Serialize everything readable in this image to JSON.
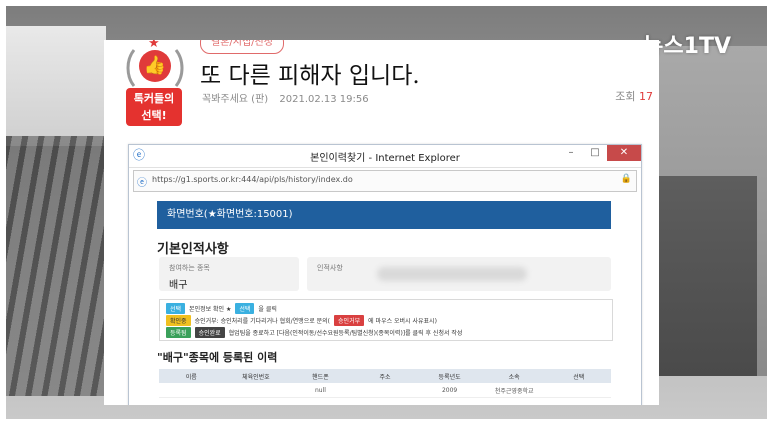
{
  "broadcast": {
    "watermark": "뉴스1TV"
  },
  "post": {
    "badge_label": "톡커들의\n선택!",
    "category": "결혼/시집/친정",
    "title": "또 다른 피해자 입니다.",
    "author": "꼭봐주세요 (판)",
    "datetime": "2021.02.13 19:56",
    "views_label": "조회",
    "views_value": "17"
  },
  "browser": {
    "title": "본인이력찾기 - Internet Explorer",
    "url": "https://g1.sports.or.kr:444/api/pls/history/index.do",
    "min_label": "–",
    "max_label": "□",
    "close_label": "✕"
  },
  "page": {
    "screen_number": "화면번호(★화면번호:15001)",
    "section_title": "기본인적사항",
    "sport_label": "참여하는 종목",
    "sport_value": "배구",
    "info_label": "인적사항",
    "legend": [
      {
        "chip": "선택",
        "chip_color": "blue",
        "text": "본인정보 확인 ★",
        "chip2": "선택",
        "text2": "을 클릭"
      },
      {
        "chip": "확인중",
        "chip_color": "yellow",
        "text": "승인거부: 승인처리를 기다리거나 협회/연맹으로 문의(",
        "chip2": "승인거부",
        "text2": "에 마우스 오버시 사유표시)"
      },
      {
        "chip": "등록됨",
        "chip_color": "green",
        "text": "",
        "chip2": "승인완료",
        "text2": "협업팀을 종료하고 [다음(인적이동/선수요원등록/팀별신청)(종목이력)]를 클릭 후 신청서 작성"
      }
    ],
    "registered_title": "\"배구\"종목에 등록된 이력",
    "table_headers": [
      "이름",
      "체육인번호",
      "핸드폰",
      "주소",
      "등록년도",
      "소속",
      "선택"
    ],
    "table_rows": [
      [
        "",
        "",
        "null",
        "",
        "2009",
        "천주근영중학교",
        ""
      ]
    ]
  },
  "icons": {
    "ie": "ie-logo-icon",
    "lock": "lock-icon",
    "thumb": "thumbs-up-icon"
  }
}
